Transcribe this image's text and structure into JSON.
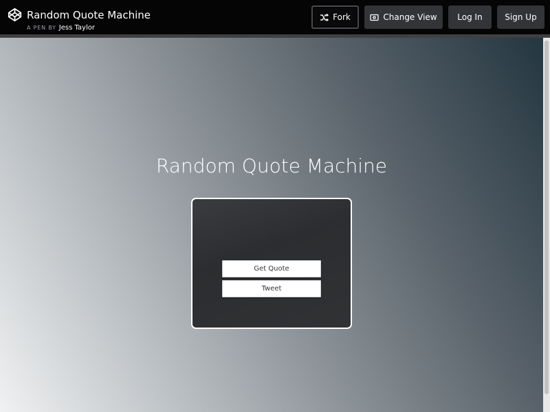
{
  "header": {
    "title": "Random Quote Machine",
    "pen_by": "A PEN BY",
    "author": "Jess Taylor",
    "logo_icon": "codepen-logo-icon"
  },
  "actions": {
    "fork": "Fork",
    "change_view": "Change View",
    "login": "Log In",
    "signup": "Sign Up"
  },
  "app": {
    "title": "Random Quote Machine",
    "get_quote": "Get Quote",
    "tweet": "Tweet"
  },
  "colors": {
    "topbar": "#050505",
    "button": "#333438",
    "accent_border": "#ffffff"
  }
}
